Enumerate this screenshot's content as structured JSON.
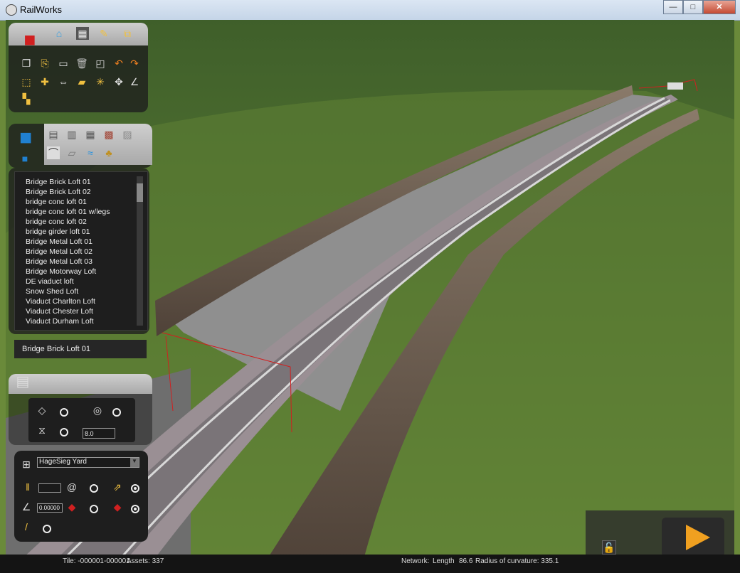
{
  "window": {
    "title": "RailWorks",
    "minimize": "—",
    "maximize": "□",
    "close": "✕"
  },
  "toolbar": {
    "tabs": [
      {
        "name": "toolbox-icon",
        "glyph": "🧰"
      },
      {
        "name": "home-icon",
        "glyph": "⌂"
      },
      {
        "name": "track-icon",
        "glyph": "▦"
      },
      {
        "name": "brush-icon",
        "glyph": "🖌"
      },
      {
        "name": "train-icon",
        "glyph": "🚆"
      }
    ],
    "tools_row1": [
      "copy-icon",
      "paste-icon",
      "monitor-icon",
      "trash-icon",
      "stamp-icon",
      "undo-icon",
      "redo-icon"
    ],
    "tools_row2": [
      "select-icon",
      "snap-icon",
      "join-icon",
      "ruler-icon",
      "spread-icon",
      "move-icon",
      "angle-icon"
    ],
    "tools_row3": [
      "tiles-icon"
    ]
  },
  "asset_browser": {
    "items": [
      "Bridge Brick Loft 01",
      "Bridge Brick Loft 02",
      "bridge conc loft 01",
      "bridge conc loft 01 w/legs",
      "bridge conc loft 02",
      "bridge girder loft 01",
      "Bridge Metal Loft 01",
      "Bridge Metal Loft 02",
      "Bridge Metal Loft 03",
      "Bridge Motorway Loft",
      "DE viaduct loft",
      "Snow Shed Loft",
      "Viaduct Charlton Loft",
      "Viaduct Chester Loft",
      "Viaduct Durham Loft"
    ],
    "selected": "Bridge Brick Loft 01"
  },
  "properties": {
    "height_value": "8.0"
  },
  "track_tools": {
    "rule_name": "HageSieg Yard",
    "field_blank": "",
    "gradient_value": "0.00000"
  },
  "status": {
    "tile": "Tile: -000001-000001",
    "assets": "Assets: 337",
    "network": "Network:",
    "length": "Length",
    "length_value": "86.6",
    "radius_label": "Radius of curvature: 335.1"
  },
  "colors": {
    "grass": "#6b8a3a",
    "panel": "#1e1e1e",
    "accent": "#f0a020",
    "bridge": "#6a5a4c"
  }
}
